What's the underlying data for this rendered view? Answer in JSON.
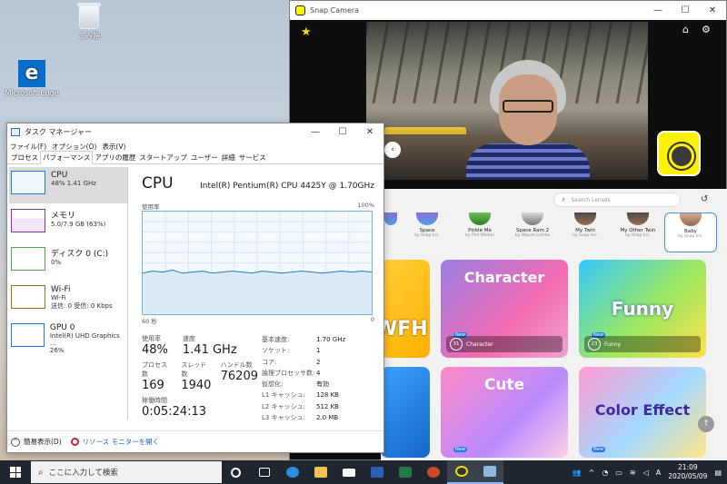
{
  "desktop": {
    "icons": [
      {
        "label": "ごみ箱"
      },
      {
        "label": "Microsoft Edge"
      }
    ]
  },
  "snap_camera": {
    "title": "Snap Camera",
    "search_placeholder": "Search Lenses",
    "lenses": [
      {
        "name": "",
        "by": ""
      },
      {
        "name": "Space",
        "by": "by Snap Inc."
      },
      {
        "name": "Pickle Me",
        "by": "by Phil Walton"
      },
      {
        "name": "Space Ram 2",
        "by": "by Wayne Lambs"
      },
      {
        "name": "My Twin",
        "by": "by Snap Inc."
      },
      {
        "name": "My Other Twin",
        "by": "by Snap Inc."
      },
      {
        "name": "Baby",
        "by": "by Snap Inc."
      }
    ],
    "cards": [
      {
        "title": "WFH",
        "count": "",
        "label": ""
      },
      {
        "title": "Character",
        "count": "31",
        "label": "Character",
        "badge": "New"
      },
      {
        "title": "Funny",
        "count": "23",
        "label": "Funny",
        "badge": "New"
      },
      {
        "title": "",
        "count": "",
        "label": ""
      },
      {
        "title": "Cute",
        "count": "",
        "label": "",
        "badge": "New"
      },
      {
        "title": "Color Effect",
        "count": "",
        "label": "",
        "badge": "New"
      }
    ]
  },
  "task_manager": {
    "title": "タスク マネージャー",
    "menu": [
      "ファイル(F)",
      "オプション(O)",
      "表示(V)"
    ],
    "tabs": [
      "プロセス",
      "パフォーマンス",
      "アプリの履歴",
      "スタートアップ",
      "ユーザー",
      "詳細",
      "サービス"
    ],
    "resources": [
      {
        "name": "CPU",
        "sub1": "48%  1.41 GHz",
        "sub2": "",
        "color": "#1f7bd0"
      },
      {
        "name": "メモリ",
        "sub1": "5.0/7.9 GB (63%)",
        "sub2": "",
        "color": "#8b2fa8"
      },
      {
        "name": "ディスク 0 (C:)",
        "sub1": "0%",
        "sub2": "",
        "color": "#4da64d"
      },
      {
        "name": "Wi-Fi",
        "sub1": "Wi-Fi",
        "sub2": "送信: 0  受信: 0 Kbps",
        "color": "#a9691c"
      },
      {
        "name": "GPU 0",
        "sub1": "Intel(R) UHD Graphics ...",
        "sub2": "26%",
        "color": "#1f7bd0"
      }
    ],
    "cpu": {
      "heading": "CPU",
      "model": "Intel(R) Pentium(R) CPU 4425Y @ 1.70GHz",
      "graph_label_left": "使用率",
      "graph_label_right": "100%",
      "axis_left": "60 秒",
      "axis_right": "0",
      "usage_series": [
        40,
        42,
        41,
        43,
        40,
        41,
        42,
        40,
        41,
        42,
        41,
        40,
        42,
        41,
        40,
        41,
        42,
        41,
        40,
        41,
        42,
        41,
        42,
        41
      ],
      "stats": [
        {
          "label": "使用率",
          "value": "48%"
        },
        {
          "label": "速度",
          "value": "1.41 GHz"
        },
        {
          "label": "プロセス数",
          "value": "169"
        },
        {
          "label": "スレッド数",
          "value": "1940"
        },
        {
          "label": "ハンドル数",
          "value": "76209"
        },
        {
          "label": "稼働時間",
          "value": "0:05:24:13"
        }
      ],
      "details": [
        {
          "k": "基本速度:",
          "v": "1.70 GHz"
        },
        {
          "k": "ソケット:",
          "v": "1"
        },
        {
          "k": "コア:",
          "v": "2"
        },
        {
          "k": "論理プロセッサ数:",
          "v": "4"
        },
        {
          "k": "仮想化:",
          "v": "有効"
        },
        {
          "k": "L1 キャッシュ:",
          "v": "128 KB"
        },
        {
          "k": "L2 キャッシュ:",
          "v": "512 KB"
        },
        {
          "k": "L3 キャッシュ:",
          "v": "2.0 MB"
        }
      ]
    },
    "footer": {
      "compact": "簡易表示(D)",
      "resource_monitor": "リソース モニターを開く"
    }
  },
  "taskbar": {
    "search_placeholder": "ここに入力して検索",
    "time": "21:09",
    "date": "2020/05/09",
    "ime": "A"
  }
}
